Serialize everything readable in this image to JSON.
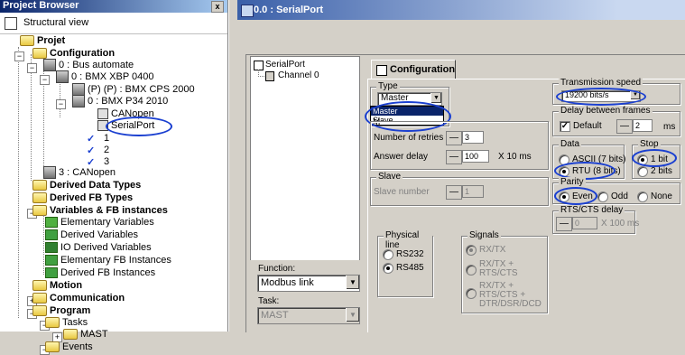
{
  "browser": {
    "title": "Project Browser",
    "close": "x",
    "structural_view": "Structural view",
    "tree": [
      {
        "label": "Projet",
        "bold": true
      },
      {
        "label": "Configuration",
        "bold": true
      },
      {
        "label": "0 : Bus automate",
        "bold": false
      },
      {
        "label": "0 : BMX XBP 0400",
        "bold": false
      },
      {
        "label": "(P) (P) : BMX CPS 2000",
        "bold": false
      },
      {
        "label": "0 : BMX P34 2010",
        "bold": false
      },
      {
        "label": "CANopen",
        "bold": false
      },
      {
        "label": "SerialPort",
        "bold": false
      },
      {
        "label": "1",
        "bold": false
      },
      {
        "label": "2",
        "bold": false
      },
      {
        "label": "3",
        "bold": false
      },
      {
        "label": "3 : CANopen",
        "bold": false
      },
      {
        "label": "Derived Data Types",
        "bold": true
      },
      {
        "label": "Derived FB Types",
        "bold": true
      },
      {
        "label": "Variables & FB instances",
        "bold": true
      },
      {
        "label": "Elementary Variables",
        "bold": false
      },
      {
        "label": "Derived Variables",
        "bold": false
      },
      {
        "label": "IO Derived Variables",
        "bold": false
      },
      {
        "label": "Elementary FB Instances",
        "bold": false
      },
      {
        "label": "Derived FB Instances",
        "bold": false
      },
      {
        "label": "Motion",
        "bold": true
      },
      {
        "label": "Communication",
        "bold": true
      },
      {
        "label": "Program",
        "bold": true
      },
      {
        "label": "Tasks",
        "bold": false
      },
      {
        "label": "MAST",
        "bold": false
      },
      {
        "label": "Events",
        "bold": false
      }
    ]
  },
  "window": {
    "title": "0.0 : SerialPort",
    "channel_tree": {
      "root": "SerialPort",
      "child": "Channel 0"
    },
    "function_label": "Function:",
    "function_value": "Modbus link",
    "task_label": "Task:",
    "task_value": "MAST"
  },
  "config": {
    "tab": "Configuration",
    "type": {
      "group": "Type",
      "value": "Master",
      "options": [
        "Master",
        "Slave"
      ],
      "partial_label": "M"
    },
    "retries": {
      "label": "Number of retries",
      "value": "3"
    },
    "answer_delay": {
      "label": "Answer delay",
      "value": "100",
      "unit": "X 10 ms"
    },
    "slave": {
      "group": "Slave",
      "label": "Slave number",
      "value": "1"
    },
    "physical_line": {
      "group": "Physical line",
      "options": [
        "RS232",
        "RS485"
      ],
      "selected": "RS485"
    },
    "signals": {
      "group": "Signals",
      "options": [
        "RX/TX",
        "RX/TX + RTS/CTS",
        "RX/TX + RTS/CTS + DTR/DSR/DCD"
      ]
    },
    "transmission": {
      "group": "Transmission speed",
      "value": "19200 bits/s"
    },
    "delay_frames": {
      "group": "Delay between frames",
      "default_label": "Default",
      "default_checked": "✓",
      "value": "2",
      "unit": "ms"
    },
    "data": {
      "group": "Data",
      "options": [
        "ASCII (7 bits)",
        "RTU (8 bits)"
      ],
      "selected": "RTU (8 bits)"
    },
    "stop": {
      "group": "Stop",
      "options": [
        "1 bit",
        "2 bits"
      ],
      "selected": "1 bit"
    },
    "parity": {
      "group": "Parity",
      "options": [
        "Even",
        "Odd",
        "None"
      ],
      "selected": "Even"
    },
    "rts_cts": {
      "group": "RTS/CTS delay",
      "value": "0",
      "unit": "X 100 ms"
    }
  },
  "colors": {
    "highlight": "#1a3fd0",
    "title_bar": "#0a246a"
  }
}
